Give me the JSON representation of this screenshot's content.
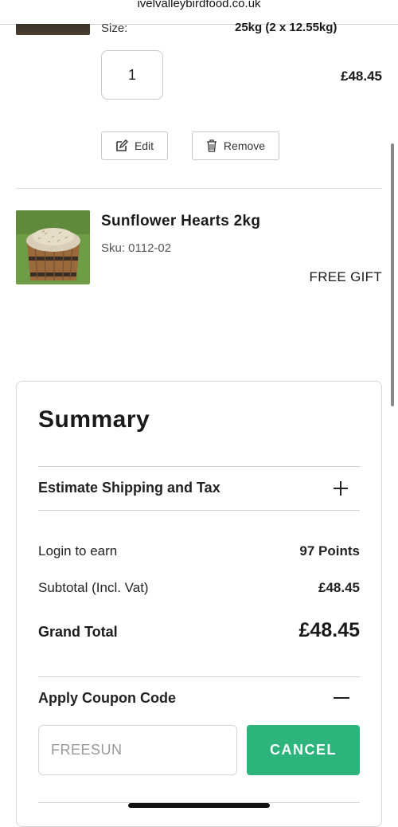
{
  "browser": {
    "url": "ivelvalleybirdfood.co.uk"
  },
  "item1": {
    "size_label": "Size:",
    "size_value": "25kg (2 x 12.55kg)",
    "quantity": "1",
    "price": "£48.45",
    "edit_label": "Edit",
    "remove_label": "Remove"
  },
  "item2": {
    "name": "Sunflower Hearts 2kg",
    "sku": "Sku: 0112-02",
    "price_label": "FREE GIFT"
  },
  "summary": {
    "title": "Summary",
    "shipping_label": "Estimate Shipping and Tax",
    "points_label": "Login to earn",
    "points_value": "97 Points",
    "subtotal_label": "Subtotal (Incl. Vat)",
    "subtotal_value": "£48.45",
    "grand_total_label": "Grand Total",
    "grand_total_value": "£48.45",
    "coupon_label": "Apply Coupon Code",
    "coupon_value": "FREESUN",
    "cancel_label": "CANCEL"
  },
  "colors": {
    "accent": "#2db47d"
  },
  "icons": [
    "edit-icon",
    "trash-icon",
    "plus-icon",
    "minus-icon"
  ]
}
